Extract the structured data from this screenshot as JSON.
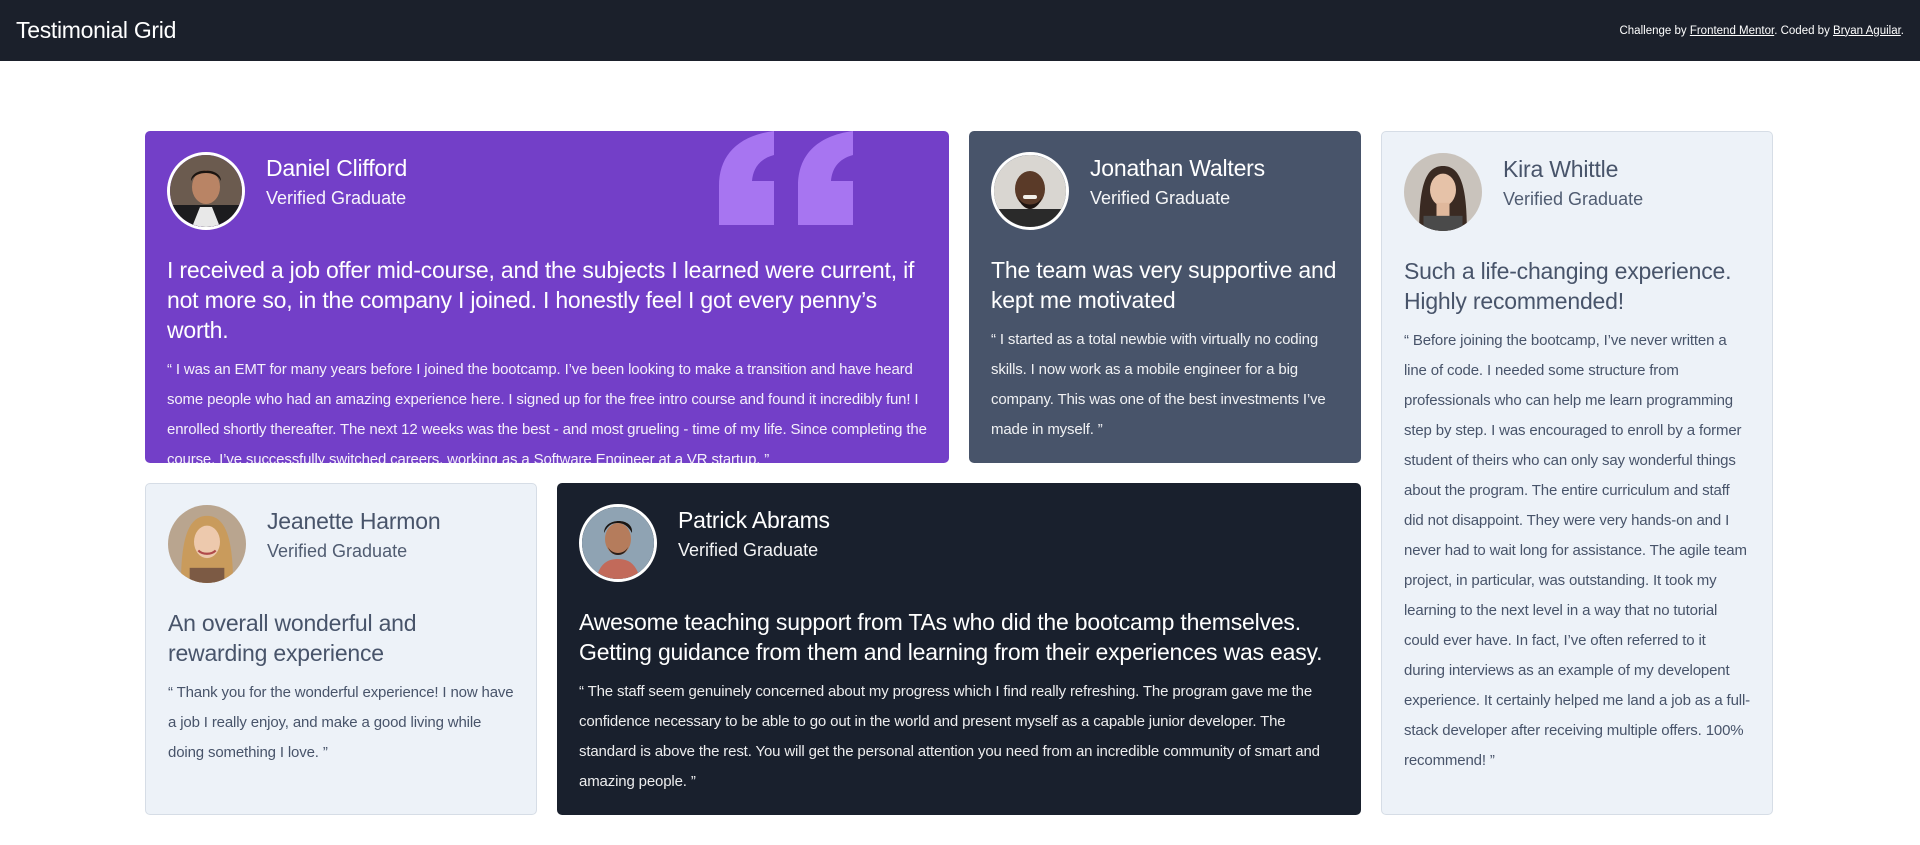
{
  "header": {
    "title": "Testimonial Grid",
    "attribution_prefix": "Challenge by ",
    "attribution_link1": "Frontend Mentor",
    "attribution_middle": ". Coded by ",
    "attribution_link2": "Bryan Aguilar",
    "attribution_suffix": "."
  },
  "colors": {
    "purple": "#733fc8",
    "slate": "#48546a",
    "light": "#edf2f8",
    "dark": "#19202d",
    "topbar": "#1b202b",
    "quote_mark": "#a775f1"
  },
  "testimonials": [
    {
      "name": "Daniel Clifford",
      "role": "Verified Graduate",
      "headline": "I received a job offer mid-course, and the subjects I learned were current, if not more so, in the company I joined. I honestly feel I got every penny’s worth.",
      "body": "“ I was an EMT for many years before I joined the bootcamp. I’ve been looking to make a transition and have heard some people who had an amazing experience here. I signed up for the free intro course and found it incredibly fun! I enrolled shortly thereafter. The next 12 weeks was the best - and most grueling - time of my life. Since completing the course, I’ve successfully switched careers, working as a Software Engineer at a VR startup. ”"
    },
    {
      "name": "Jonathan Walters",
      "role": "Verified Graduate",
      "headline": "The team was very supportive and kept me motivated",
      "body": "“ I started as a total newbie with virtually no coding skills. I now work as a mobile engineer for a big company. This was one of the best investments I’ve made in myself. ”"
    },
    {
      "name": "Kira Whittle",
      "role": "Verified Graduate",
      "headline": "Such a life-changing experience. Highly recommended!",
      "body": "“ Before joining the bootcamp, I’ve never written a line of code. I needed some structure from professionals who can help me learn programming step by step. I was encouraged to enroll by a former student of theirs who can only say wonderful things about the program. The entire curriculum and staff did not disappoint. They were very hands-on and I never had to wait long for assistance. The agile team project, in particular, was outstanding. It took my learning to the next level in a way that no tutorial could ever have. In fact, I’ve often referred to it during interviews as an example of my developent experience. It certainly helped me land a job as a full-stack developer after receiving multiple offers. 100% recommend! ”"
    },
    {
      "name": "Jeanette Harmon",
      "role": "Verified Graduate",
      "headline": "An overall wonderful and rewarding experience",
      "body": "“ Thank you for the wonderful experience! I now have a job I really enjoy, and make a good living while doing something I love. ”"
    },
    {
      "name": "Patrick Abrams",
      "role": "Verified Graduate",
      "headline": "Awesome teaching support from TAs who did the bootcamp themselves. Getting guidance from them and learning from their experiences was easy.",
      "body": "“ The staff seem genuinely concerned about my progress which I find really refreshing. The program gave me the confidence necessary to be able to go out in the world and present myself as a capable junior developer. The standard is above the rest. You will get the personal attention you need from an incredible community of smart and amazing people. ”"
    }
  ]
}
